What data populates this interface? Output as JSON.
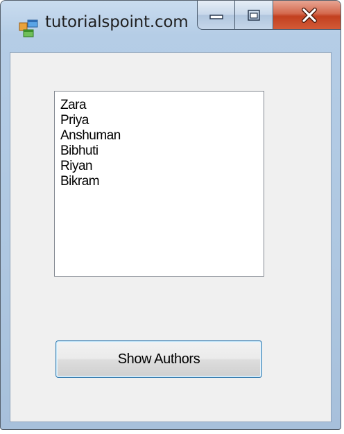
{
  "window": {
    "title": "tutorialspoint.com",
    "icon": "form-app-icon",
    "caption_buttons": [
      "minimize-icon",
      "maximize-icon",
      "close-icon"
    ]
  },
  "listbox": {
    "items": [
      "Zara",
      "Priya",
      "Anshuman",
      "Bibhuti",
      "Riyan",
      "Bikram"
    ]
  },
  "show_authors_button": {
    "label": "Show Authors"
  },
  "colors": {
    "client_background": "#f0f0f0",
    "close_button_red": "#c2401f",
    "button_focus_border": "#3c7fb1"
  }
}
